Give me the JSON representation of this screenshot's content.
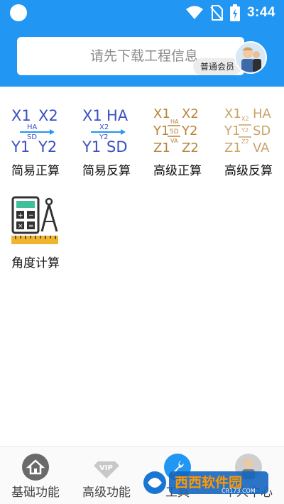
{
  "status": {
    "time": "3:44",
    "icons": [
      "circle-indicator",
      "wifi-icon",
      "no-sim-icon",
      "battery-charging-icon"
    ]
  },
  "header": {
    "placeholder": "请先下载工程信息",
    "member_badge": "普通会员",
    "accent_color": "#2196f3"
  },
  "tools": [
    {
      "id": "simple-forward",
      "label": "简易正算",
      "icon_lines": [
        "X1",
        "X2",
        "HA",
        "SD",
        "Y1",
        "Y2"
      ],
      "color": "#3a50c2"
    },
    {
      "id": "simple-inverse",
      "label": "简易反算",
      "icon_lines": [
        "X1",
        "HA",
        "X2",
        "Y2",
        "Y1",
        "SD"
      ],
      "color": "#3a50c2"
    },
    {
      "id": "advanced-forward",
      "label": "高级正算",
      "icon_lines": [
        "X1",
        "X2",
        "HA",
        "Y1",
        "SD",
        "Y2",
        "VA",
        "Z1",
        "Z2"
      ],
      "color": "#b8843c"
    },
    {
      "id": "advanced-inverse",
      "label": "高级反算",
      "icon_lines": [
        "X1",
        "X2",
        "HA",
        "Y1",
        "Y2",
        "SD",
        "Z1",
        "Z2",
        "VA"
      ],
      "color": "#c9a46a"
    },
    {
      "id": "angle-calc",
      "label": "角度计算",
      "icon_lines": [],
      "color": "#3a3a3a"
    }
  ],
  "nav": [
    {
      "label": "基础功能",
      "icon": "home-icon",
      "active": false
    },
    {
      "label": "高级功能",
      "icon": "vip-diamond-icon",
      "active": false
    },
    {
      "label": "工具",
      "icon": "wrench-icon",
      "active": true
    },
    {
      "label": "个人中心",
      "icon": "avatar-icon",
      "active": false
    }
  ],
  "watermark": {
    "brand": "西西软件园",
    "site": "CR173.COM"
  }
}
